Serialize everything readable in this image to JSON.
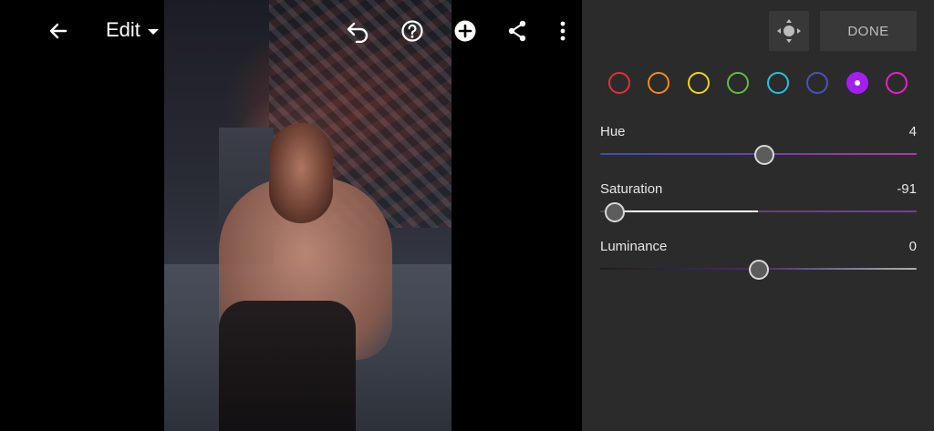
{
  "toolbar": {
    "title": "Edit",
    "icons": [
      "back-arrow-icon",
      "undo-icon",
      "help-icon",
      "add-icon",
      "share-icon",
      "more-icon"
    ]
  },
  "panel": {
    "done_label": "DONE",
    "target_icon": "targeted-adjustment-icon",
    "colors": [
      {
        "name": "red",
        "hex": "#e0313c"
      },
      {
        "name": "orange",
        "hex": "#f08a24"
      },
      {
        "name": "yellow",
        "hex": "#f2d21b"
      },
      {
        "name": "green",
        "hex": "#65b84a"
      },
      {
        "name": "aqua",
        "hex": "#26c3d9"
      },
      {
        "name": "blue",
        "hex": "#4a53b8"
      },
      {
        "name": "purple",
        "hex": "#a21ff0",
        "selected": true
      },
      {
        "name": "magenta",
        "hex": "#e025c8"
      }
    ],
    "sliders": [
      {
        "label": "Hue",
        "value": "4",
        "level": 0.52
      },
      {
        "label": "Saturation",
        "value": "-91",
        "level": 0.045
      },
      {
        "label": "Luminance",
        "value": "0",
        "level": 0.5
      }
    ]
  }
}
